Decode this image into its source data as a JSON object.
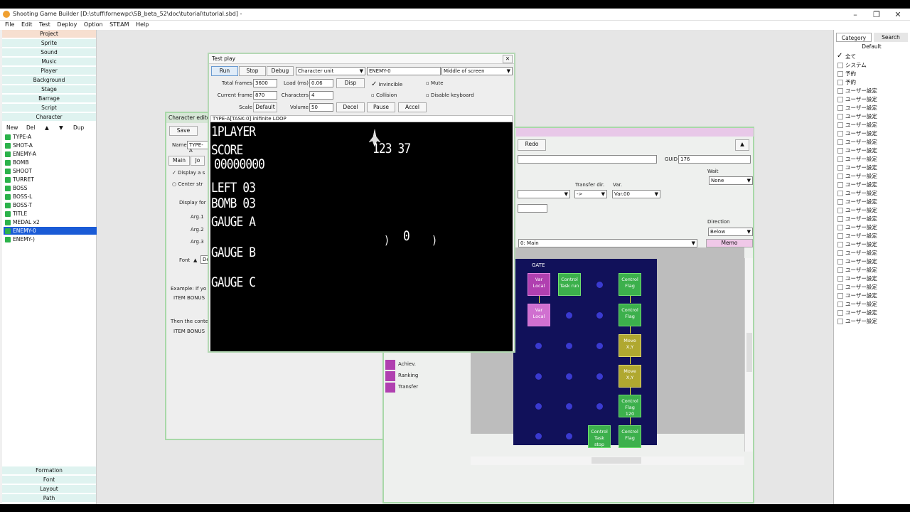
{
  "window": {
    "title": "Shooting Game Builder [D:\\stuff\\fornewpc\\SB_beta_52\\doc\\tutorial\\tutorial.sbd] -",
    "minimize": "–",
    "maximize": "❐",
    "close": "✕"
  },
  "menu": [
    "File",
    "Edit",
    "Test",
    "Deploy",
    "Option",
    "STEAM",
    "Help"
  ],
  "left_nav": {
    "top": [
      "Project",
      "Sprite",
      "Sound",
      "Music",
      "Player",
      "Background",
      "Stage",
      "Barrage",
      "Script",
      "Character"
    ],
    "toolbar": [
      "New",
      "Del",
      "▲",
      "▼",
      "Dup"
    ],
    "characters": [
      "TYPE-A",
      "SHOT-A",
      "ENEMY-A",
      "BOMB",
      "SHOOT",
      "TURRET",
      "BOSS",
      "BOSS-L",
      "BOSS-T",
      "TITLE",
      "MEDAL x2",
      "ENEMY-0",
      "ENEMY-)"
    ],
    "selected": "ENEMY-0",
    "bottom": [
      "Formation",
      "Font",
      "Layout",
      "Path"
    ]
  },
  "char_editor": {
    "title": "Character edito",
    "save": "Save",
    "name_label": "Name",
    "name_value": "TYPE-A",
    "tabs": [
      "Main",
      "Jo"
    ],
    "display_check": "Display a s",
    "center_check": "Center str",
    "display_for": "Display for",
    "args": [
      "Arg.1",
      "Arg.2",
      "Arg.3"
    ],
    "font_label": "Font",
    "font_value": "De",
    "example1": "Example: If yo",
    "example2": "ITEM BONUS",
    "then1": "Then the conte",
    "then2": "ITEM BONUS"
  },
  "script_editor": {
    "redo": "Redo",
    "up": "▲",
    "guid_label": "GUID",
    "guid_value": "176",
    "wait_label": "Wait",
    "wait_value": "None",
    "transfer_label": "Transfer dir.",
    "transfer_value": "->",
    "var_label": "Var.",
    "var_value": "Var.00",
    "direction_label": "Direction",
    "direction_value": "Below",
    "task_value": "0: Main",
    "memo": "Memo",
    "side_items": [
      "Achiev.",
      "Ranking",
      "Transfer"
    ],
    "gate_label": "GATE",
    "nodes": [
      {
        "label": "Var\nLocal",
        "type": "var"
      },
      {
        "label": "Control\nTask run",
        "type": "control"
      },
      {
        "label": "Control\nFlag",
        "type": "control"
      },
      {
        "label": "Var\nLocal",
        "type": "var"
      },
      {
        "label": "Control\nFlag",
        "type": "control"
      },
      {
        "label": "Move\nX,Y",
        "type": "move"
      },
      {
        "label": "Move\nX,Y",
        "type": "move"
      },
      {
        "label": "Control\nFlag\n120",
        "type": "control"
      },
      {
        "label": "Control\nTask stop",
        "type": "control"
      },
      {
        "label": "Control\nFlag",
        "type": "control"
      }
    ]
  },
  "right_pane": {
    "tabs": [
      "Category",
      "Search"
    ],
    "default": "Default",
    "categories": [
      {
        "label": "全て",
        "checked": true
      },
      {
        "label": "システム",
        "checked": false
      },
      {
        "label": "予約",
        "checked": false
      },
      {
        "label": "予約",
        "checked": false
      },
      {
        "label": "ユーザー設定",
        "checked": false
      },
      {
        "label": "ユーザー設定",
        "checked": false
      },
      {
        "label": "ユーザー設定",
        "checked": false
      },
      {
        "label": "ユーザー設定",
        "checked": false
      },
      {
        "label": "ユーザー設定",
        "checked": false
      },
      {
        "label": "ユーザー設定",
        "checked": false
      },
      {
        "label": "ユーザー設定",
        "checked": false
      },
      {
        "label": "ユーザー設定",
        "checked": false
      },
      {
        "label": "ユーザー設定",
        "checked": false
      },
      {
        "label": "ユーザー設定",
        "checked": false
      },
      {
        "label": "ユーザー設定",
        "checked": false
      },
      {
        "label": "ユーザー設定",
        "checked": false
      },
      {
        "label": "ユーザー設定",
        "checked": false
      },
      {
        "label": "ユーザー設定",
        "checked": false
      },
      {
        "label": "ユーザー設定",
        "checked": false
      },
      {
        "label": "ユーザー設定",
        "checked": false
      },
      {
        "label": "ユーザー設定",
        "checked": false
      },
      {
        "label": "ユーザー設定",
        "checked": false
      },
      {
        "label": "ユーザー設定",
        "checked": false
      },
      {
        "label": "ユーザー設定",
        "checked": false
      },
      {
        "label": "ユーザー設定",
        "checked": false
      },
      {
        "label": "ユーザー設定",
        "checked": false
      },
      {
        "label": "ユーザー設定",
        "checked": false
      },
      {
        "label": "ユーザー設定",
        "checked": false
      },
      {
        "label": "ユーザー設定",
        "checked": false
      },
      {
        "label": "ユーザー設定",
        "checked": false
      },
      {
        "label": "ユーザー設定",
        "checked": false
      },
      {
        "label": "ユーザー設定",
        "checked": false
      }
    ]
  },
  "test_play": {
    "title": "Test play",
    "close": "✕",
    "run": "Run",
    "stop": "Stop",
    "debug": "Debug",
    "unit_value": "Character unit",
    "char_value": "ENEMY-0",
    "pos_value": "Middle of screen",
    "total_frames_label": "Total frames",
    "total_frames": "3600",
    "load_label": "Load (ms)",
    "load": "0.06",
    "disp": "Disp",
    "invincible": "Invincible",
    "mute": "Mute",
    "current_frame_label": "Current frame",
    "current_frame": "870",
    "characters_label": "Characters",
    "characters": "4",
    "collision": "Collision",
    "disable_keyboard": "Disable keyboard",
    "scale_label": "Scale",
    "scale": "Default",
    "volume_label": "Volume",
    "volume": "50",
    "decel": "Decel",
    "pause": "Pause",
    "accel": "Accel",
    "status": "TYPE-A[TASK:0] inifinite LOOP",
    "game": {
      "player": "1PLAYER",
      "score_label": "SCORE",
      "score": "00000000",
      "counter": "123 37",
      "left": "LEFT 03",
      "bomb": "BOMB 03",
      "gauge_a": "GAUGE A",
      "gauge_b": "GAUGE B",
      "gauge_c": "GAUGE C",
      "paren_l": ")",
      "zero": "0",
      "paren_r": ")"
    }
  },
  "colors": {
    "accent": "#1a5bd6",
    "nav": "#dff3f0",
    "var_node": "#b040b0",
    "control_node": "#3cb04c",
    "move_node": "#b0a830",
    "canvas": "#11115a"
  }
}
